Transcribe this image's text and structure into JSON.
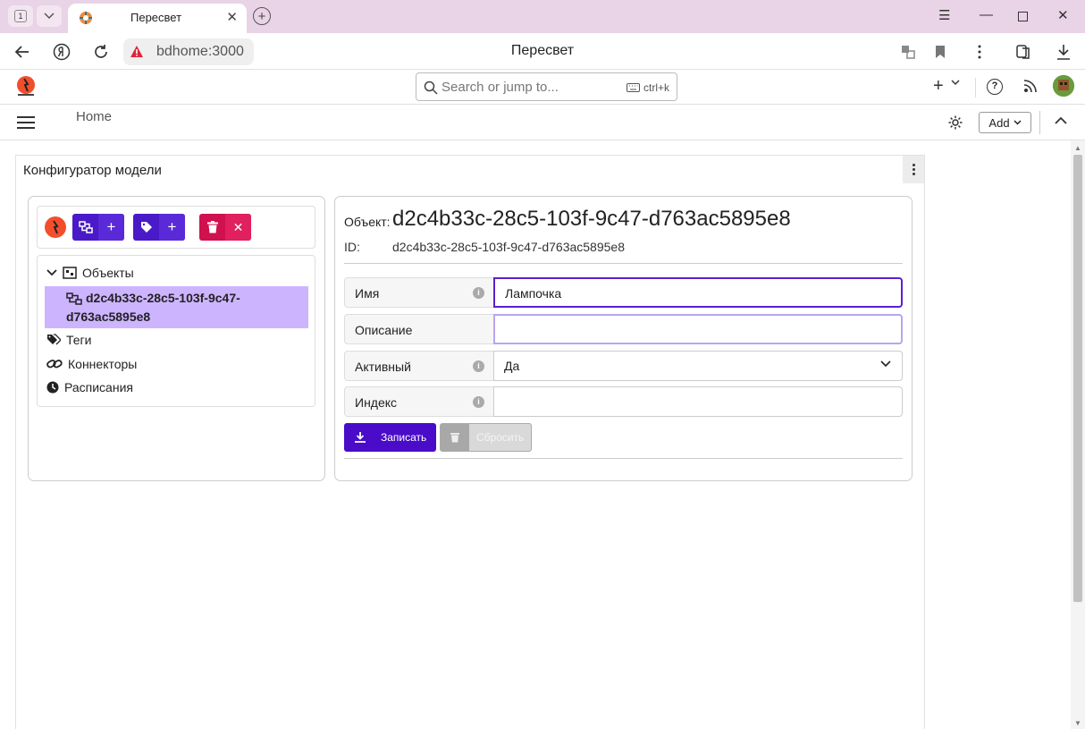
{
  "browser": {
    "tab_count": "1",
    "tab_title": "Пересвет",
    "url": "bdhome:3000",
    "page_title": "Пересвет"
  },
  "header": {
    "search_placeholder": "Search or jump to...",
    "search_shortcut": "ctrl+k"
  },
  "toolbar": {
    "breadcrumb": "Home",
    "add_label": "Add"
  },
  "panel": {
    "title": "Конфигуратор модели"
  },
  "tree": {
    "root_label": "Объекты",
    "selected_item": "d2c4b33c-28c5-103f-9c47-d763ac5895e8",
    "tags_label": "Теги",
    "connectors_label": "Коннекторы",
    "schedules_label": "Расписания"
  },
  "detail": {
    "object_label": "Объект:",
    "object_name": "d2c4b33c-28c5-103f-9c47-d763ac5895e8",
    "id_label": "ID:",
    "id_value": "d2c4b33c-28c5-103f-9c47-d763ac5895e8",
    "fields": [
      {
        "label": "Имя",
        "value": "Лампочка"
      },
      {
        "label": "Описание",
        "value": ""
      },
      {
        "label": "Активный",
        "value": "Да"
      },
      {
        "label": "Индекс",
        "value": ""
      }
    ],
    "save_label": "Записать",
    "reset_label": "Сбросить"
  },
  "colors": {
    "accent": "#4a0cc8",
    "danger": "#d0104f",
    "selection": "#cdb4ff"
  }
}
